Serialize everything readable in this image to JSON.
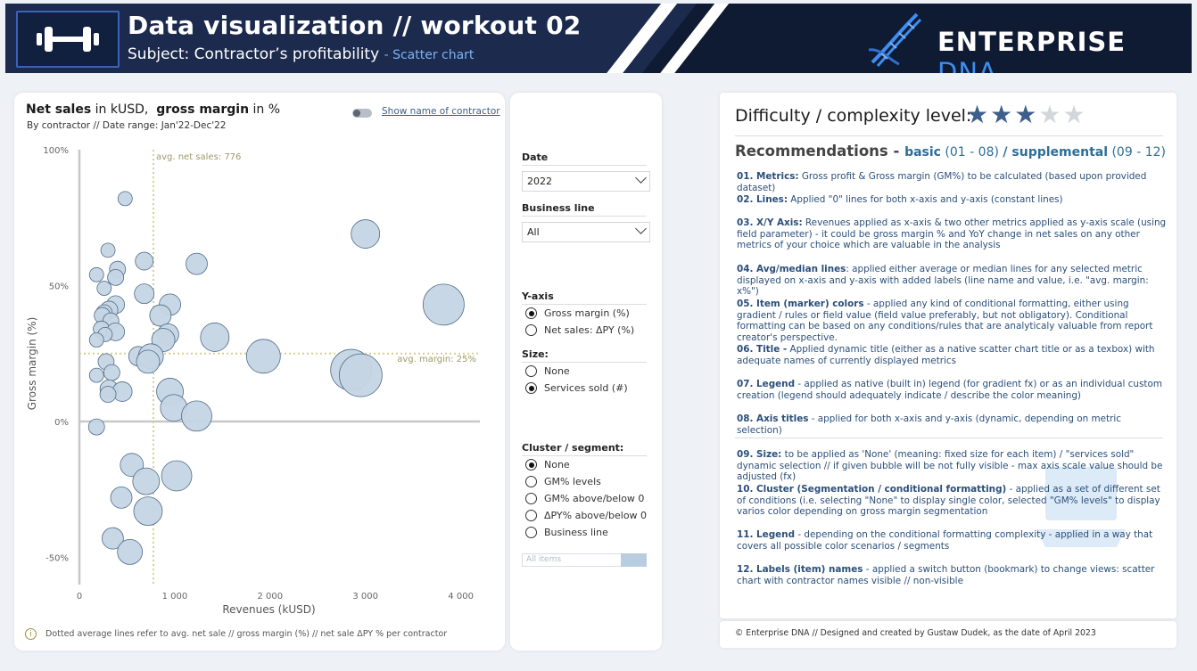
{
  "header": {
    "title": "Data visualization // workout 02",
    "subtitle": "Subject: Contractor’s profitability",
    "subtitle_accent": "- Scatter chart",
    "brand_main": "ENTERPRISE ",
    "brand_accent": "DNA",
    "logo_icon": "dumbbell-icon",
    "brand_icon": "dna-icon"
  },
  "chart_panel": {
    "title_part1": "Net sales",
    "title_part2": " in kUSD,  ",
    "title_part3": "gross margin",
    "title_part4": " in %",
    "subtitle": "By contractor // Date range: Jan'22-Dec'22",
    "toggle_label": "Show name of contractor",
    "footnote": "Dotted average lines refer to avg. net sale // gross margin (%) // net sale ΔPY % per contractor",
    "avg_x_label": "avg. net sales: 776",
    "avg_y_label": "avg. margin: 25%"
  },
  "chart_data": {
    "type": "scatter",
    "xlabel": "Revenues (kUSD)",
    "ylabel": "Gross margin (%)",
    "xlim": [
      0,
      4200
    ],
    "ylim": [
      -60,
      100
    ],
    "x_ticks": [
      0,
      1000,
      2000,
      3000,
      4000
    ],
    "x_tick_labels": [
      "0",
      "1 000",
      "2 000",
      "3 000",
      "4 000"
    ],
    "y_ticks": [
      100,
      50,
      0,
      -50
    ],
    "y_tick_labels": [
      "100%",
      "50%",
      "0%",
      "-50%"
    ],
    "avg_x": 776,
    "avg_y": 25,
    "grid": false,
    "point_color": "#c5d5e4",
    "point_stroke": "#4e6b86",
    "points": [
      {
        "x": 480,
        "y": 82,
        "size": 8
      },
      {
        "x": 300,
        "y": 63,
        "size": 8
      },
      {
        "x": 680,
        "y": 59,
        "size": 10
      },
      {
        "x": 400,
        "y": 56,
        "size": 9
      },
      {
        "x": 180,
        "y": 54,
        "size": 8
      },
      {
        "x": 1230,
        "y": 58,
        "size": 12
      },
      {
        "x": 3000,
        "y": 69,
        "size": 16
      },
      {
        "x": 380,
        "y": 53,
        "size": 9
      },
      {
        "x": 260,
        "y": 49,
        "size": 8
      },
      {
        "x": 680,
        "y": 47,
        "size": 11
      },
      {
        "x": 950,
        "y": 43,
        "size": 12
      },
      {
        "x": 380,
        "y": 43,
        "size": 10
      },
      {
        "x": 310,
        "y": 41,
        "size": 10
      },
      {
        "x": 260,
        "y": 40,
        "size": 9
      },
      {
        "x": 240,
        "y": 39,
        "size": 9
      },
      {
        "x": 850,
        "y": 39,
        "size": 12
      },
      {
        "x": 330,
        "y": 37,
        "size": 9
      },
      {
        "x": 230,
        "y": 34,
        "size": 9
      },
      {
        "x": 380,
        "y": 33,
        "size": 10
      },
      {
        "x": 270,
        "y": 32,
        "size": 8
      },
      {
        "x": 930,
        "y": 32,
        "size": 12
      },
      {
        "x": 880,
        "y": 30,
        "size": 13
      },
      {
        "x": 180,
        "y": 30,
        "size": 8
      },
      {
        "x": 1420,
        "y": 31,
        "size": 16
      },
      {
        "x": 3820,
        "y": 43,
        "size": 23
      },
      {
        "x": 620,
        "y": 24,
        "size": 11
      },
      {
        "x": 750,
        "y": 24,
        "size": 14
      },
      {
        "x": 720,
        "y": 22,
        "size": 13
      },
      {
        "x": 1930,
        "y": 24,
        "size": 19
      },
      {
        "x": 2850,
        "y": 19,
        "size": 23
      },
      {
        "x": 2950,
        "y": 17,
        "size": 24
      },
      {
        "x": 280,
        "y": 22,
        "size": 9
      },
      {
        "x": 340,
        "y": 18,
        "size": 9
      },
      {
        "x": 180,
        "y": 17,
        "size": 8
      },
      {
        "x": 950,
        "y": 11,
        "size": 15
      },
      {
        "x": 310,
        "y": 12,
        "size": 10
      },
      {
        "x": 450,
        "y": 11,
        "size": 11
      },
      {
        "x": 300,
        "y": 10,
        "size": 9
      },
      {
        "x": 990,
        "y": 5,
        "size": 15
      },
      {
        "x": 1230,
        "y": 2,
        "size": 17
      },
      {
        "x": 180,
        "y": -2,
        "size": 9
      },
      {
        "x": 550,
        "y": -16,
        "size": 13
      },
      {
        "x": 1020,
        "y": -20,
        "size": 17
      },
      {
        "x": 700,
        "y": -22,
        "size": 15
      },
      {
        "x": 440,
        "y": -28,
        "size": 12
      },
      {
        "x": 720,
        "y": -33,
        "size": 16
      },
      {
        "x": 350,
        "y": -43,
        "size": 12
      },
      {
        "x": 530,
        "y": -48,
        "size": 14
      }
    ]
  },
  "filters": {
    "date_label": "Date",
    "date_value": "2022",
    "business_label": "Business line",
    "business_value": "All",
    "yaxis_label": "Y-axis",
    "yaxis_options": [
      "Gross margin (%)",
      "Net sales: ΔPY (%)"
    ],
    "yaxis_selected": 0,
    "size_label": "Size:",
    "size_options": [
      "None",
      "Services sold (#)"
    ],
    "size_selected": 1,
    "cluster_label": "Cluster / segment:",
    "cluster_options": [
      "None",
      "GM% levels",
      "GM% above/below 0",
      "ΔPY% above/below 0",
      "Business line"
    ],
    "cluster_selected": 0,
    "search_placeholder": "All items"
  },
  "reco": {
    "heading": "Difficulty / complexity level:",
    "stars_on": 3,
    "stars_total": 5,
    "sub_main": "Recommendations",
    "sub_dash": " - ",
    "sub_basic": "basic",
    "sub_basic_range": " (01 - 08) ",
    "sub_slash": "/ ",
    "sub_sup": "supplemental",
    "sub_sup_range": " (09 - 12)",
    "items": [
      {
        "k": "01. Metrics:",
        "t": " Gross profit & Gross margin (GM%) to be calculated (based upon provided dataset)"
      },
      {
        "k": "02. Lines:",
        "t": " Applied \"0\" lines for both x-axis and y-axis (constant lines)"
      },
      {
        "k": "03. X/Y Axis:",
        "t": " Revenues applied as x-axis & two other metrics applied as y-axis scale (using field parameter) - it could be gross margin % and YoY change in net sales on any other metrics of your choice which are valuable in the analysis"
      },
      {
        "k": "04. Avg/median lines",
        "t": ": applied either average or median lines for any selected metric displayed on x-axis and y-axis with added labels (line name and value, i.e. \"avg. margin: x%\")"
      },
      {
        "k": "05. Item (marker) colors",
        "t": " - applied any kind of conditional formatting, either using gradient / rules or field value (field value preferably, but not obligatory). Conditional formatting can be based on any conditions/rules that are analyticaly valuable from report creator's perspective."
      },
      {
        "k": "06. Title -",
        "t": "  Applied dynamic title (either as a native scatter chart title or as a texbox) with adequate names of currently displayed metrics"
      },
      {
        "k": "07. Legend",
        "t": " - applied as native (built in) legend (for gradient fx) or as an individual custom creation (legend should adequately indicate / describe the color meaning)"
      },
      {
        "k": "08. Axis titles",
        "t": " - applied for both x-axis and y-axis (dynamic, depending on metric selection)"
      },
      {
        "k": "09. Size:",
        "t": " to be applied as 'None' (meaning: fixed size for each item) / \"services sold\" dynamic selection // if given bubble will be not fully visible - max axis scale value should be adjusted (fx)"
      },
      {
        "k": "10. Cluster (Segmentation / conditional formatting)",
        "t": " - applied as a set of different set of conditions (i.e. selecting \"None\" to display single color, selected \"GM% levels\" to display varios color depending on gross margin segmentation"
      },
      {
        "k": "11. Legend",
        "t": " - depending on the conditional formatting complexity - applied in a way that covers all possible color scenarios / segments"
      },
      {
        "k": "12. Labels (item) names",
        "t": " - applied a switch button (bookmark) to change views: scatter chart with contractor names visible // non-visible"
      }
    ],
    "footer": "© Enterprise DNA // Designed and created by Gustaw Dudek, as the date of April 2023"
  }
}
